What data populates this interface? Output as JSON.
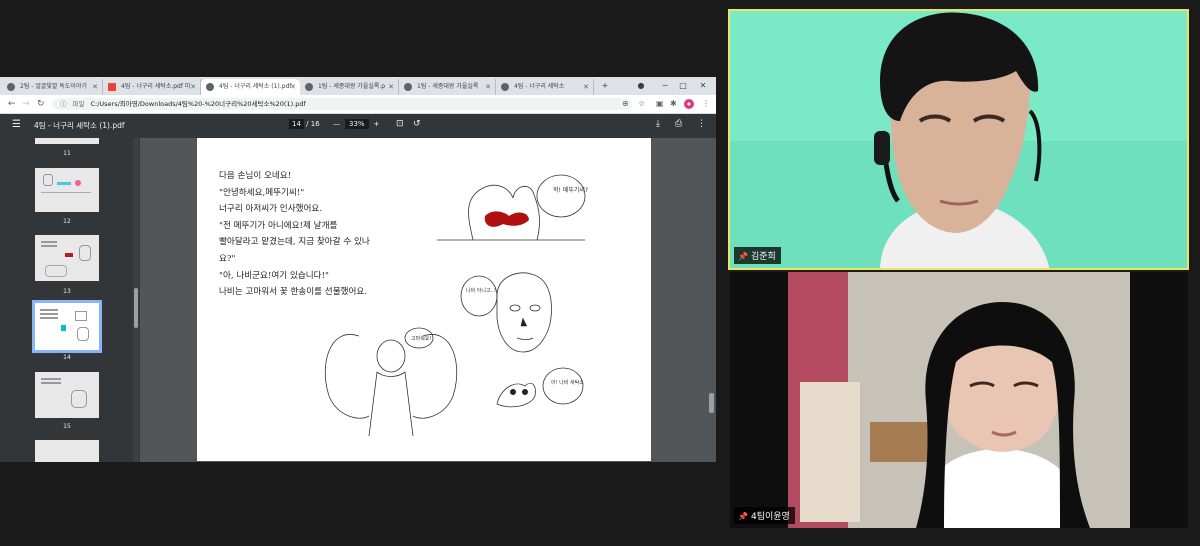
{
  "browser": {
    "tabs": [
      {
        "label": "2팀 - 얼굴빛깔 독도이야기"
      },
      {
        "label": "4팀 - 너구리 세탁소.pdf 미"
      },
      {
        "label": "4팀 - 너구리 세탁소 (1).pdf"
      },
      {
        "label": "1팀 - 세종대왕 가을실록.p"
      },
      {
        "label": "1팀 - 세종대왕 가을실록"
      },
      {
        "label": "4팀 - 너구리 세탁소"
      }
    ],
    "new_tab": "+",
    "address": {
      "scheme": "파일",
      "url": "C:/Users/최아영/Downloads/4팀%20-%20너구리%20세탁소%20(1).pdf"
    }
  },
  "pdf": {
    "title": "4팀 - 너구리 세탁소 (1).pdf",
    "current_page": "14",
    "total_pages": "/ 16",
    "zoom": "33%",
    "thumbnails": [
      {
        "label": "11"
      },
      {
        "label": "12"
      },
      {
        "label": "13"
      },
      {
        "label": "14"
      },
      {
        "label": "15"
      }
    ],
    "story_lines": [
      "다음 손님이 오네요!",
      "\"안녕하세요,메뚜기씨!\"",
      "너구리 아저씨가 인사했어요.",
      "\"전 메뚜기가 아니에요!제 날개를",
      "빨아달라고 맡겼는데, 지금 찾아갈 수 있나",
      "요?\"",
      "\"아, 나비군요!여기 있습니다!\"",
      "나비는 고마워서 꽃 한송이를 선물했어요."
    ],
    "speech_bubbles": [
      "헉! 메뚜기씨?",
      "나비 아니고..?",
      "아! 나비 새탁소",
      "고마워요!"
    ]
  },
  "participants": [
    {
      "name": "김준희"
    },
    {
      "name": "4팀이윤영"
    }
  ],
  "colors": {
    "video1_bg": "#7ae9c6",
    "active_speaker_border": "#e9e36a",
    "pdf_toolbar": "#323639"
  }
}
